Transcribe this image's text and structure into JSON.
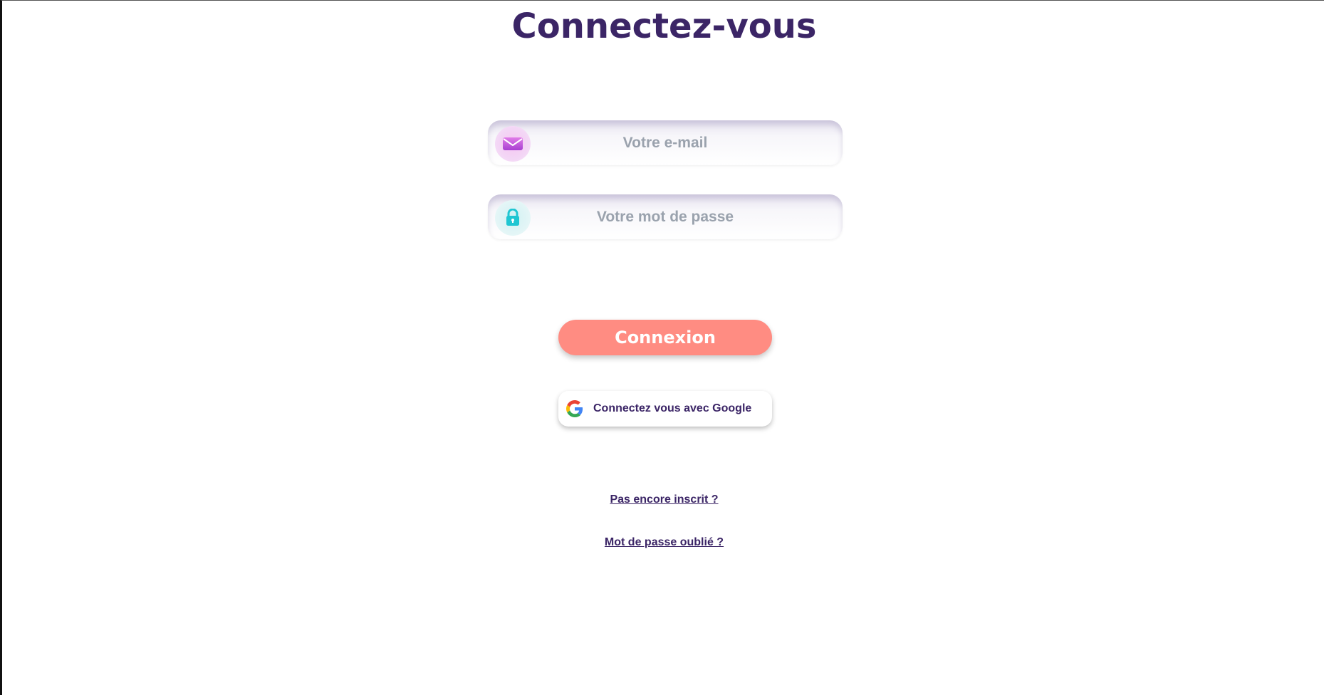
{
  "page": {
    "title": "Connectez-vous"
  },
  "form": {
    "email": {
      "placeholder": "Votre e-mail",
      "value": "",
      "icon": "envelope-icon"
    },
    "password": {
      "placeholder": "Votre mot de passe",
      "value": "",
      "icon": "lock-icon"
    },
    "submit_label": "Connexion",
    "google_label": "Connectez vous avec Google",
    "google_icon": "google-icon"
  },
  "links": {
    "signup": "Pas encore inscrit ?",
    "forgot_password": "Mot de passe oublié ?"
  },
  "colors": {
    "title": "#3b2566",
    "primary_button": "#ff8c82",
    "email_icon": "#c455e0",
    "password_icon": "#1fc6d2"
  }
}
